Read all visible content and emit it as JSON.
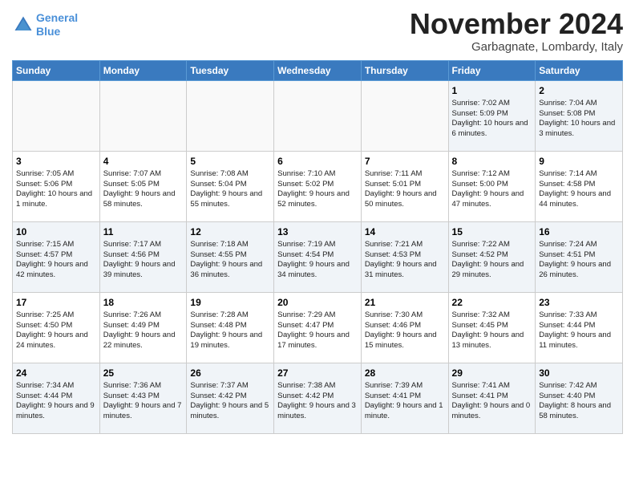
{
  "logo": {
    "line1": "General",
    "line2": "Blue"
  },
  "title": "November 2024",
  "subtitle": "Garbagnate, Lombardy, Italy",
  "headers": [
    "Sunday",
    "Monday",
    "Tuesday",
    "Wednesday",
    "Thursday",
    "Friday",
    "Saturday"
  ],
  "weeks": [
    [
      {
        "day": "",
        "info": ""
      },
      {
        "day": "",
        "info": ""
      },
      {
        "day": "",
        "info": ""
      },
      {
        "day": "",
        "info": ""
      },
      {
        "day": "",
        "info": ""
      },
      {
        "day": "1",
        "info": "Sunrise: 7:02 AM\nSunset: 5:09 PM\nDaylight: 10 hours and 6 minutes."
      },
      {
        "day": "2",
        "info": "Sunrise: 7:04 AM\nSunset: 5:08 PM\nDaylight: 10 hours and 3 minutes."
      }
    ],
    [
      {
        "day": "3",
        "info": "Sunrise: 7:05 AM\nSunset: 5:06 PM\nDaylight: 10 hours and 1 minute."
      },
      {
        "day": "4",
        "info": "Sunrise: 7:07 AM\nSunset: 5:05 PM\nDaylight: 9 hours and 58 minutes."
      },
      {
        "day": "5",
        "info": "Sunrise: 7:08 AM\nSunset: 5:04 PM\nDaylight: 9 hours and 55 minutes."
      },
      {
        "day": "6",
        "info": "Sunrise: 7:10 AM\nSunset: 5:02 PM\nDaylight: 9 hours and 52 minutes."
      },
      {
        "day": "7",
        "info": "Sunrise: 7:11 AM\nSunset: 5:01 PM\nDaylight: 9 hours and 50 minutes."
      },
      {
        "day": "8",
        "info": "Sunrise: 7:12 AM\nSunset: 5:00 PM\nDaylight: 9 hours and 47 minutes."
      },
      {
        "day": "9",
        "info": "Sunrise: 7:14 AM\nSunset: 4:58 PM\nDaylight: 9 hours and 44 minutes."
      }
    ],
    [
      {
        "day": "10",
        "info": "Sunrise: 7:15 AM\nSunset: 4:57 PM\nDaylight: 9 hours and 42 minutes."
      },
      {
        "day": "11",
        "info": "Sunrise: 7:17 AM\nSunset: 4:56 PM\nDaylight: 9 hours and 39 minutes."
      },
      {
        "day": "12",
        "info": "Sunrise: 7:18 AM\nSunset: 4:55 PM\nDaylight: 9 hours and 36 minutes."
      },
      {
        "day": "13",
        "info": "Sunrise: 7:19 AM\nSunset: 4:54 PM\nDaylight: 9 hours and 34 minutes."
      },
      {
        "day": "14",
        "info": "Sunrise: 7:21 AM\nSunset: 4:53 PM\nDaylight: 9 hours and 31 minutes."
      },
      {
        "day": "15",
        "info": "Sunrise: 7:22 AM\nSunset: 4:52 PM\nDaylight: 9 hours and 29 minutes."
      },
      {
        "day": "16",
        "info": "Sunrise: 7:24 AM\nSunset: 4:51 PM\nDaylight: 9 hours and 26 minutes."
      }
    ],
    [
      {
        "day": "17",
        "info": "Sunrise: 7:25 AM\nSunset: 4:50 PM\nDaylight: 9 hours and 24 minutes."
      },
      {
        "day": "18",
        "info": "Sunrise: 7:26 AM\nSunset: 4:49 PM\nDaylight: 9 hours and 22 minutes."
      },
      {
        "day": "19",
        "info": "Sunrise: 7:28 AM\nSunset: 4:48 PM\nDaylight: 9 hours and 19 minutes."
      },
      {
        "day": "20",
        "info": "Sunrise: 7:29 AM\nSunset: 4:47 PM\nDaylight: 9 hours and 17 minutes."
      },
      {
        "day": "21",
        "info": "Sunrise: 7:30 AM\nSunset: 4:46 PM\nDaylight: 9 hours and 15 minutes."
      },
      {
        "day": "22",
        "info": "Sunrise: 7:32 AM\nSunset: 4:45 PM\nDaylight: 9 hours and 13 minutes."
      },
      {
        "day": "23",
        "info": "Sunrise: 7:33 AM\nSunset: 4:44 PM\nDaylight: 9 hours and 11 minutes."
      }
    ],
    [
      {
        "day": "24",
        "info": "Sunrise: 7:34 AM\nSunset: 4:44 PM\nDaylight: 9 hours and 9 minutes."
      },
      {
        "day": "25",
        "info": "Sunrise: 7:36 AM\nSunset: 4:43 PM\nDaylight: 9 hours and 7 minutes."
      },
      {
        "day": "26",
        "info": "Sunrise: 7:37 AM\nSunset: 4:42 PM\nDaylight: 9 hours and 5 minutes."
      },
      {
        "day": "27",
        "info": "Sunrise: 7:38 AM\nSunset: 4:42 PM\nDaylight: 9 hours and 3 minutes."
      },
      {
        "day": "28",
        "info": "Sunrise: 7:39 AM\nSunset: 4:41 PM\nDaylight: 9 hours and 1 minute."
      },
      {
        "day": "29",
        "info": "Sunrise: 7:41 AM\nSunset: 4:41 PM\nDaylight: 9 hours and 0 minutes."
      },
      {
        "day": "30",
        "info": "Sunrise: 7:42 AM\nSunset: 4:40 PM\nDaylight: 8 hours and 58 minutes."
      }
    ]
  ]
}
